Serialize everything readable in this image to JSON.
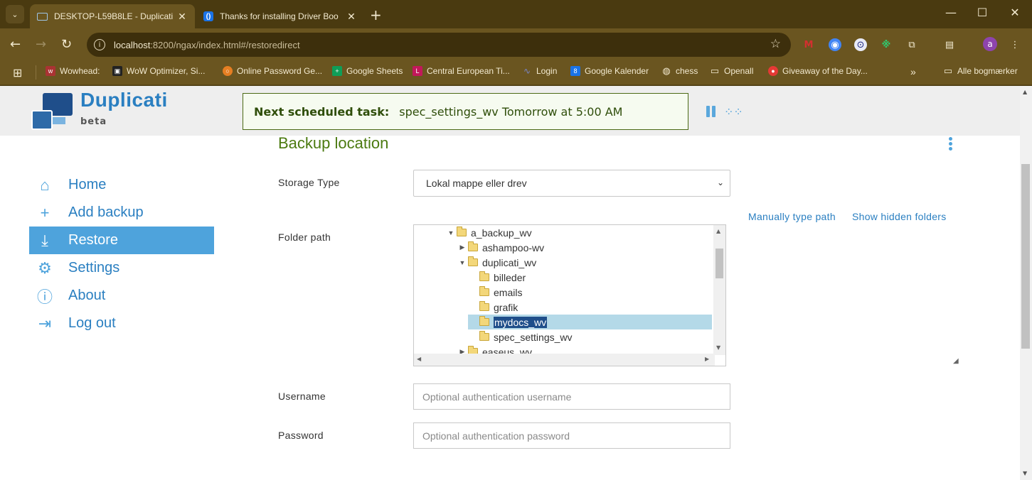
{
  "browser": {
    "tabs": [
      {
        "title": "DESKTOP-L59B8LE - Duplicati",
        "close": "✕"
      },
      {
        "title": "Thanks for installing Driver Boo",
        "close": "✕"
      }
    ],
    "new_tab": "+",
    "address": {
      "host": "localhost",
      "rest": ":8200/ngax/index.html#/restoredirect"
    },
    "avatar_letter": "a",
    "bookmarks": [
      {
        "label": "Wowhead:",
        "icon": "wowhead-icon",
        "color": "#a33"
      },
      {
        "label": "WoW Optimizer, Si...",
        "icon": "wow-optimizer-icon",
        "color": "#222"
      },
      {
        "label": "Online Password Ge...",
        "icon": "password-gen-icon",
        "color": "#e67e22"
      },
      {
        "label": "Google Sheets",
        "icon": "google-sheets-icon",
        "color": "#0f9d58"
      },
      {
        "label": "Central European Ti...",
        "icon": "cet-icon",
        "color": "#c2185b"
      },
      {
        "label": "Login",
        "icon": "login-wave-icon",
        "color": "#3949ab"
      },
      {
        "label": "Google Kalender",
        "icon": "google-calendar-icon",
        "color": "#1a73e8"
      },
      {
        "label": "chess",
        "icon": "globe-icon",
        "color": "#f3ead0"
      },
      {
        "label": "Openall",
        "icon": "folder-icon",
        "color": "#f3ead0"
      },
      {
        "label": "Giveaway of the Day...",
        "icon": "giveaway-icon",
        "color": "#e53935"
      }
    ],
    "overflow": "»",
    "all_bookmarks": "Alle bogmærker"
  },
  "app": {
    "brand": "Duplicati",
    "brand_sub": "beta",
    "task_label": "Next scheduled task:",
    "task_value": "spec_settings_wv Tomorrow at 5:00 AM"
  },
  "nav": [
    {
      "label": "Home",
      "icon": "home-icon"
    },
    {
      "label": "Add backup",
      "icon": "plus-icon"
    },
    {
      "label": "Restore",
      "icon": "restore-icon"
    },
    {
      "label": "Settings",
      "icon": "gear-icon"
    },
    {
      "label": "About",
      "icon": "info-icon"
    },
    {
      "label": "Log out",
      "icon": "logout-icon"
    }
  ],
  "form": {
    "section_title": "Backup location",
    "storage_type_label": "Storage Type",
    "storage_type_value": "Lokal mappe eller drev",
    "folder_path_label": "Folder path",
    "manual_link": "Manually type path",
    "hidden_link": "Show hidden folders",
    "username_label": "Username",
    "username_placeholder": "Optional authentication username",
    "password_label": "Password",
    "password_placeholder": "Optional authentication password"
  },
  "tree": [
    {
      "name": "a_backup_wv",
      "depth": 0,
      "state": "open"
    },
    {
      "name": "ashampoo-wv",
      "depth": 1,
      "state": "closed"
    },
    {
      "name": "duplicati_wv",
      "depth": 1,
      "state": "open"
    },
    {
      "name": "billeder",
      "depth": 2,
      "state": "leaf"
    },
    {
      "name": "emails",
      "depth": 2,
      "state": "leaf"
    },
    {
      "name": "grafik",
      "depth": 2,
      "state": "leaf"
    },
    {
      "name": "mydocs_wv",
      "depth": 2,
      "state": "leaf",
      "selected": true
    },
    {
      "name": "spec_settings_wv",
      "depth": 2,
      "state": "leaf"
    },
    {
      "name": "easeus_wv",
      "depth": 1,
      "state": "closed"
    }
  ]
}
